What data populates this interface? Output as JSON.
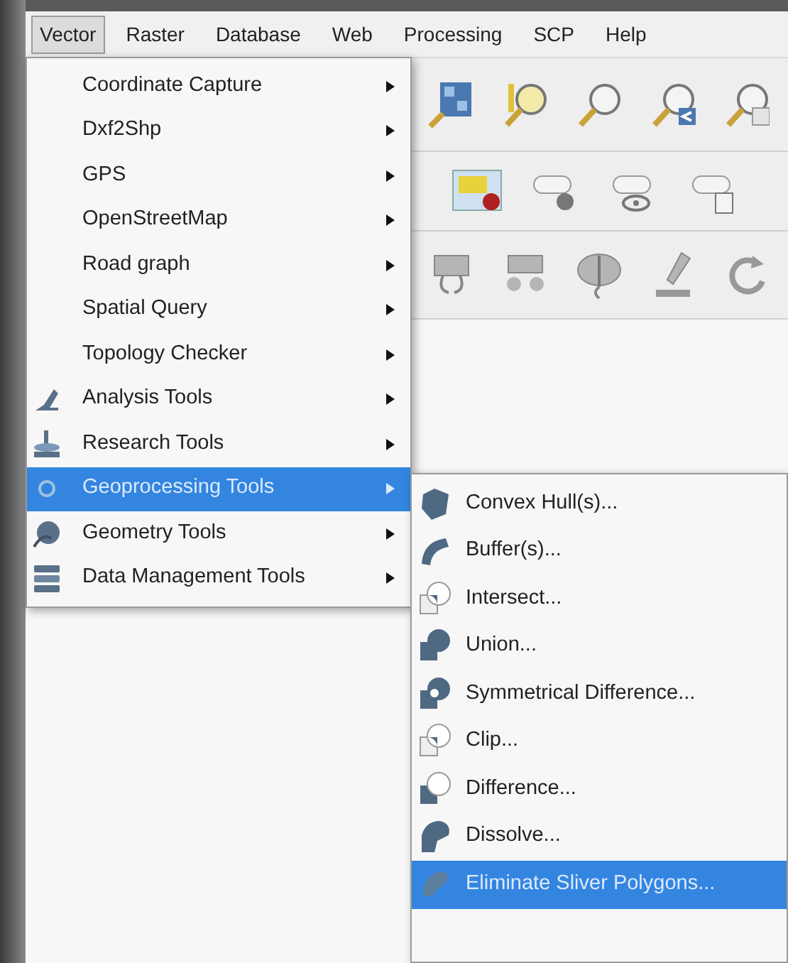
{
  "menubar": [
    {
      "label": "Vector",
      "selected": true
    },
    {
      "label": "Raster",
      "selected": false
    },
    {
      "label": "Database",
      "selected": false
    },
    {
      "label": "Web",
      "selected": false
    },
    {
      "label": "Processing",
      "selected": false
    },
    {
      "label": "SCP",
      "selected": false
    },
    {
      "label": "Help",
      "selected": false
    }
  ],
  "vector_menu": [
    {
      "label": "Coordinate Capture",
      "selected": false
    },
    {
      "label": "Dxf2Shp",
      "selected": false
    },
    {
      "label": "GPS",
      "selected": false
    },
    {
      "label": "OpenStreetMap",
      "selected": false
    },
    {
      "label": "Road graph",
      "selected": false
    },
    {
      "label": "Spatial Query",
      "selected": false
    },
    {
      "label": "Topology Checker",
      "selected": false
    },
    {
      "label": "Analysis Tools",
      "selected": false
    },
    {
      "label": "Research Tools",
      "selected": false
    },
    {
      "label": "Geoprocessing Tools",
      "selected": true
    },
    {
      "label": "Geometry Tools",
      "selected": false
    },
    {
      "label": "Data Management Tools",
      "selected": false
    }
  ],
  "geoprocessing_submenu": [
    {
      "label": "Convex Hull(s)...",
      "selected": false
    },
    {
      "label": "Buffer(s)...",
      "selected": false
    },
    {
      "label": "Intersect...",
      "selected": false
    },
    {
      "label": "Union...",
      "selected": false
    },
    {
      "label": "Symmetrical Difference...",
      "selected": false
    },
    {
      "label": "Clip...",
      "selected": false
    },
    {
      "label": "Difference...",
      "selected": false
    },
    {
      "label": "Dissolve...",
      "selected": false
    },
    {
      "label": "Eliminate Sliver Polygons...",
      "selected": true
    }
  ]
}
